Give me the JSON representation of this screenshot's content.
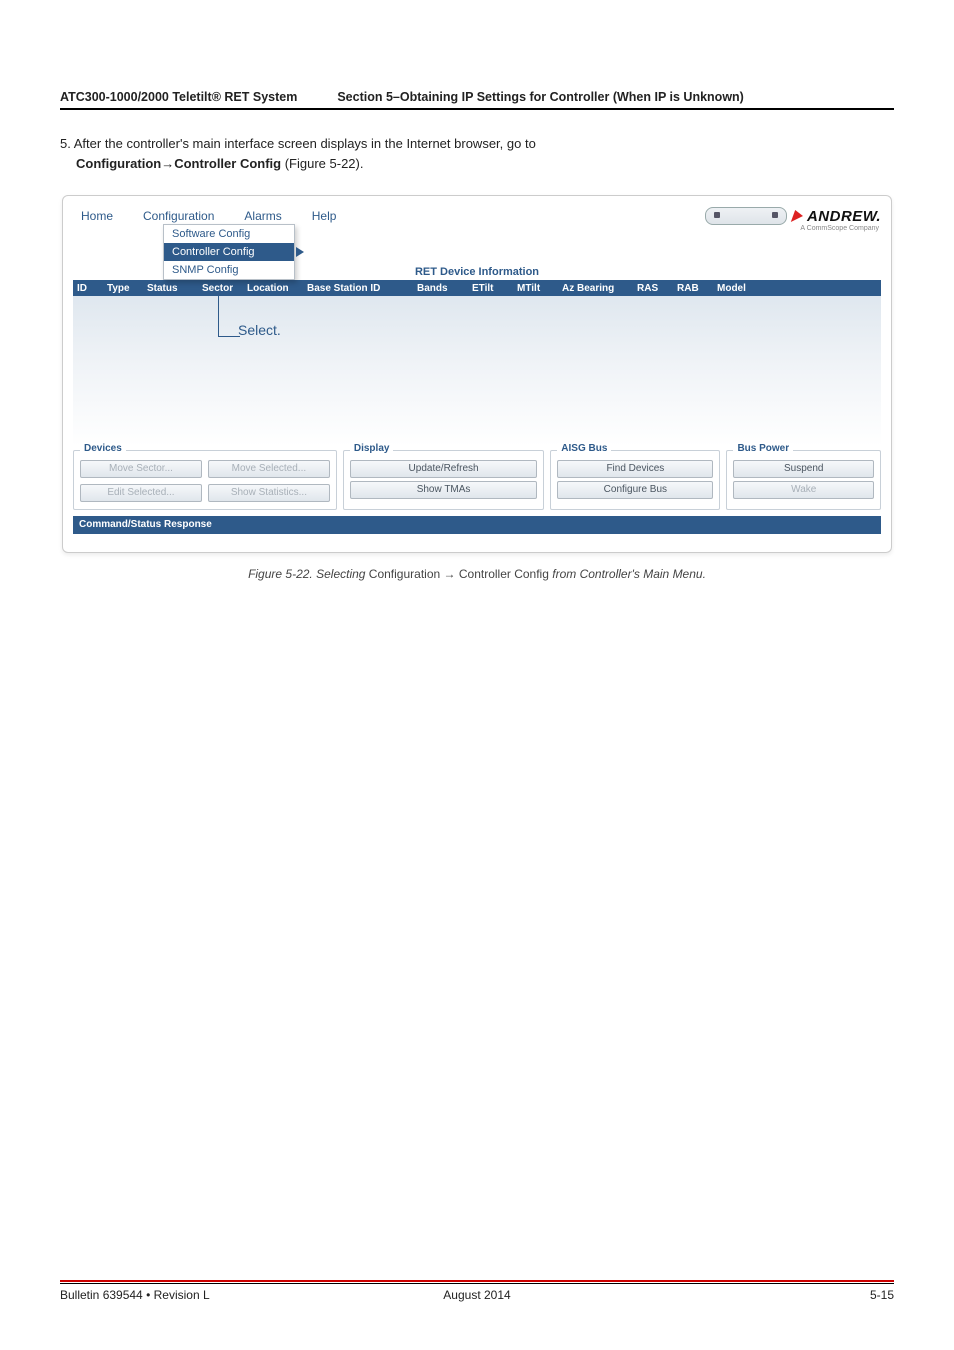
{
  "header": {
    "left": "ATC300-1000/2000 Teletilt® RET System",
    "right": "Section 5–Obtaining IP Settings for Controller (When IP is Unknown)"
  },
  "step": {
    "num": "5. ",
    "line1": "After the controller's main interface screen displays in the Internet browser, go to",
    "line2_a": "Configuration",
    "line2_arrow": "→",
    "line2_b": "Controller Config",
    "line2_c": " (Figure 5-22)."
  },
  "shot": {
    "menus": {
      "home": "Home",
      "config": "Configuration",
      "alarms": "Alarms",
      "help": "Help"
    },
    "submenu": {
      "a": "Software Config",
      "b": "Controller Config",
      "c": "SNMP Config"
    },
    "logo_text": "ANDREW.",
    "logo_sub": "A CommScope Company",
    "ret_title": "RET Device Information",
    "cols": {
      "id": "ID",
      "type": "Type",
      "status": "Status",
      "sector": "Sector",
      "location": "Location",
      "base": "Base Station ID",
      "bands": "Bands",
      "etilt": "ETilt",
      "mtilt": "MTilt",
      "az": "Az Bearing",
      "ras": "RAS",
      "rab": "RAB",
      "model": "Model"
    },
    "select_label": "Select.",
    "panels": {
      "devices": {
        "title": "Devices",
        "b1": "Move Sector...",
        "b2": "Move Selected...",
        "b3": "Edit Selected...",
        "b4": "Show Statistics..."
      },
      "display": {
        "title": "Display",
        "b1": "Update/Refresh",
        "b2": "Show TMAs"
      },
      "aisg": {
        "title": "AISG Bus",
        "b1": "Find Devices",
        "b2": "Configure Bus"
      },
      "bus": {
        "title": "Bus Power",
        "b1": "Suspend",
        "b2": "Wake"
      }
    },
    "cmd": "Command/Status Response"
  },
  "caption": {
    "pre": "Figure 5-22. Selecting ",
    "a": "Configuration",
    "arrow": " → ",
    "b": "Controller Config",
    "post": " from Controller's Main Menu."
  },
  "footer": {
    "left": "Bulletin 639544  •  Revision L",
    "center": "August 2014",
    "right": "5-15"
  }
}
